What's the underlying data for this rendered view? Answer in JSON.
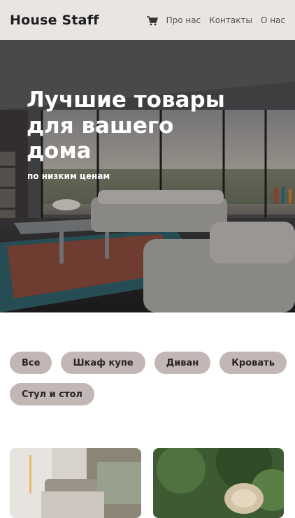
{
  "header": {
    "logo": "House Staff",
    "nav": [
      {
        "label": "Про нас"
      },
      {
        "label": "Контакты"
      },
      {
        "label": "О нас"
      }
    ]
  },
  "hero": {
    "title": "Лучшие товары для вашего дома",
    "subtitle": "по низким ценам"
  },
  "filters": [
    {
      "label": "Все"
    },
    {
      "label": "Шкаф купе"
    },
    {
      "label": "Диван"
    },
    {
      "label": "Кровать"
    },
    {
      "label": "Стул и стол"
    }
  ],
  "colors": {
    "header_bg": "#e9e5e3",
    "chip_bg": "#c3b7b6"
  }
}
